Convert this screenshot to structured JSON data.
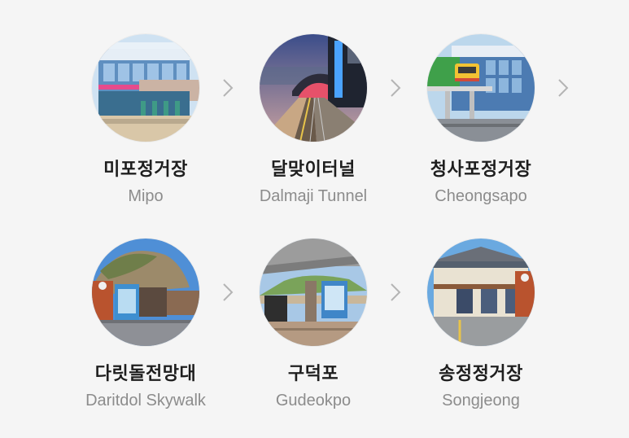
{
  "stops": [
    {
      "name_ko": "미포정거장",
      "name_en": "Mipo"
    },
    {
      "name_ko": "달맞이터널",
      "name_en": "Dalmaji Tunnel"
    },
    {
      "name_ko": "청사포정거장",
      "name_en": "Cheongsapo"
    },
    {
      "name_ko": "다릿돌전망대",
      "name_en": "Daritdol Skywalk"
    },
    {
      "name_ko": "구덕포",
      "name_en": "Gudeokpo"
    },
    {
      "name_ko": "송정정거장",
      "name_en": "Songjeong"
    }
  ],
  "icons": {
    "arrow": "chevron-right-icon"
  },
  "colors": {
    "background": "#f5f5f5",
    "title": "#1e1e1e",
    "subtitle": "#8c8c8c",
    "arrow": "#b4b4b4"
  }
}
